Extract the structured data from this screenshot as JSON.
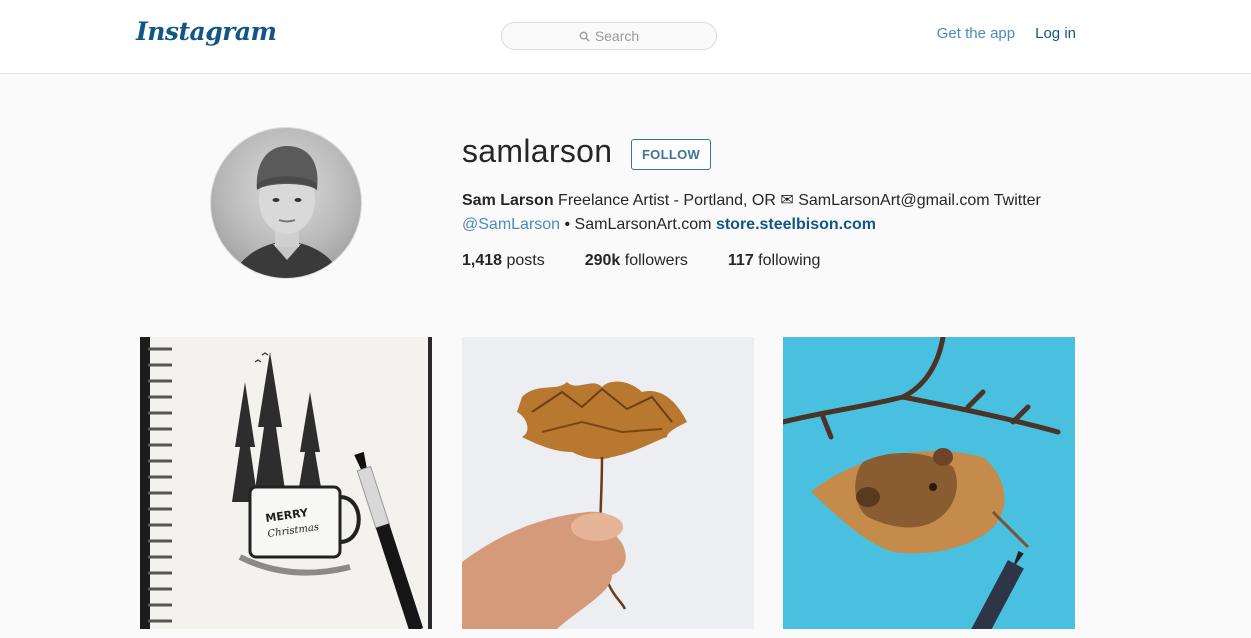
{
  "header": {
    "logo": "Instagram",
    "search_placeholder": "Search",
    "get_app": "Get the app",
    "login": "Log in"
  },
  "profile": {
    "username": "samlarson",
    "follow_label": "FOLLOW",
    "bio": {
      "name": "Sam Larson",
      "line1": " Freelance Artist - Portland, OR ",
      "email": " SamLarsonArt@gmail.com Twitter",
      "twitter": "@SamLarson",
      "sep": " • SamLarsonArt.com ",
      "store": "store.steelbison.com"
    },
    "stats": [
      {
        "value": "1,418",
        "label": " posts"
      },
      {
        "value": "290k",
        "label": " followers"
      },
      {
        "value": "117",
        "label": " following"
      }
    ]
  },
  "posts": [
    {
      "mug_text_1": "MERRY",
      "mug_text_2": "Christmas"
    },
    {},
    {}
  ],
  "colors": {
    "brand": "#125688",
    "link": "#4b8bbf",
    "post3_bg": "#47bfe0"
  }
}
